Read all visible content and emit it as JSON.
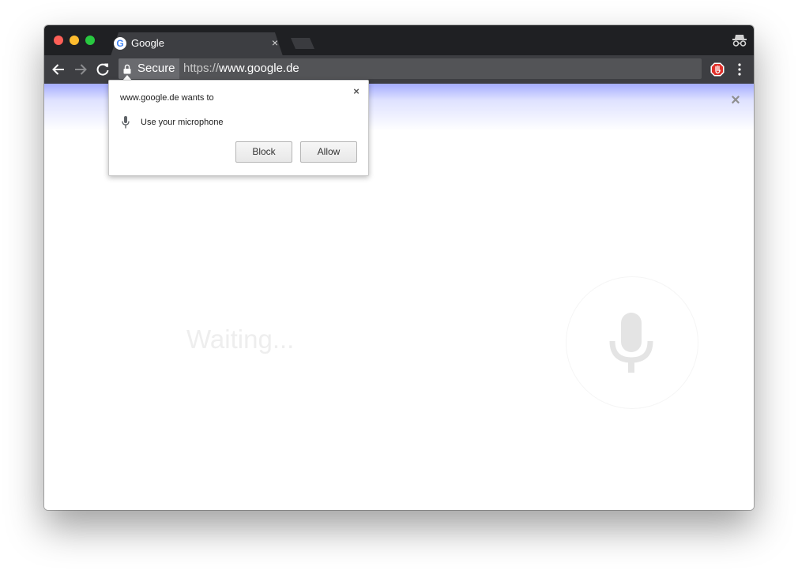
{
  "window": {
    "colors": {
      "titlebar": "#1f2023",
      "toolbar": "#3d3e42",
      "omnibox": "#535457",
      "glow": "#6d7aff"
    },
    "traffic_lights": [
      "close",
      "minimize",
      "zoom"
    ]
  },
  "tab": {
    "title": "Google",
    "close_glyph": "×",
    "favicon": "G",
    "favicon_icon": "google-favicon-icon"
  },
  "toolbar": {
    "icons": [
      "back-arrow-icon",
      "forward-arrow-icon",
      "reload-icon",
      "star-icon",
      "adblock-extension-icon",
      "menu-dots-icon",
      "incognito-icon"
    ]
  },
  "omnibox": {
    "secure_label": "Secure",
    "url_scheme": "https://",
    "url_host": "www.google.de"
  },
  "popup": {
    "title": "www.google.de wants to",
    "close_glyph": "×",
    "permission": "Use your microphone",
    "block_label": "Block",
    "allow_label": "Allow"
  },
  "content": {
    "close_glyph": "×",
    "status": "Waiting...",
    "mic_icon": "microphone-icon"
  }
}
